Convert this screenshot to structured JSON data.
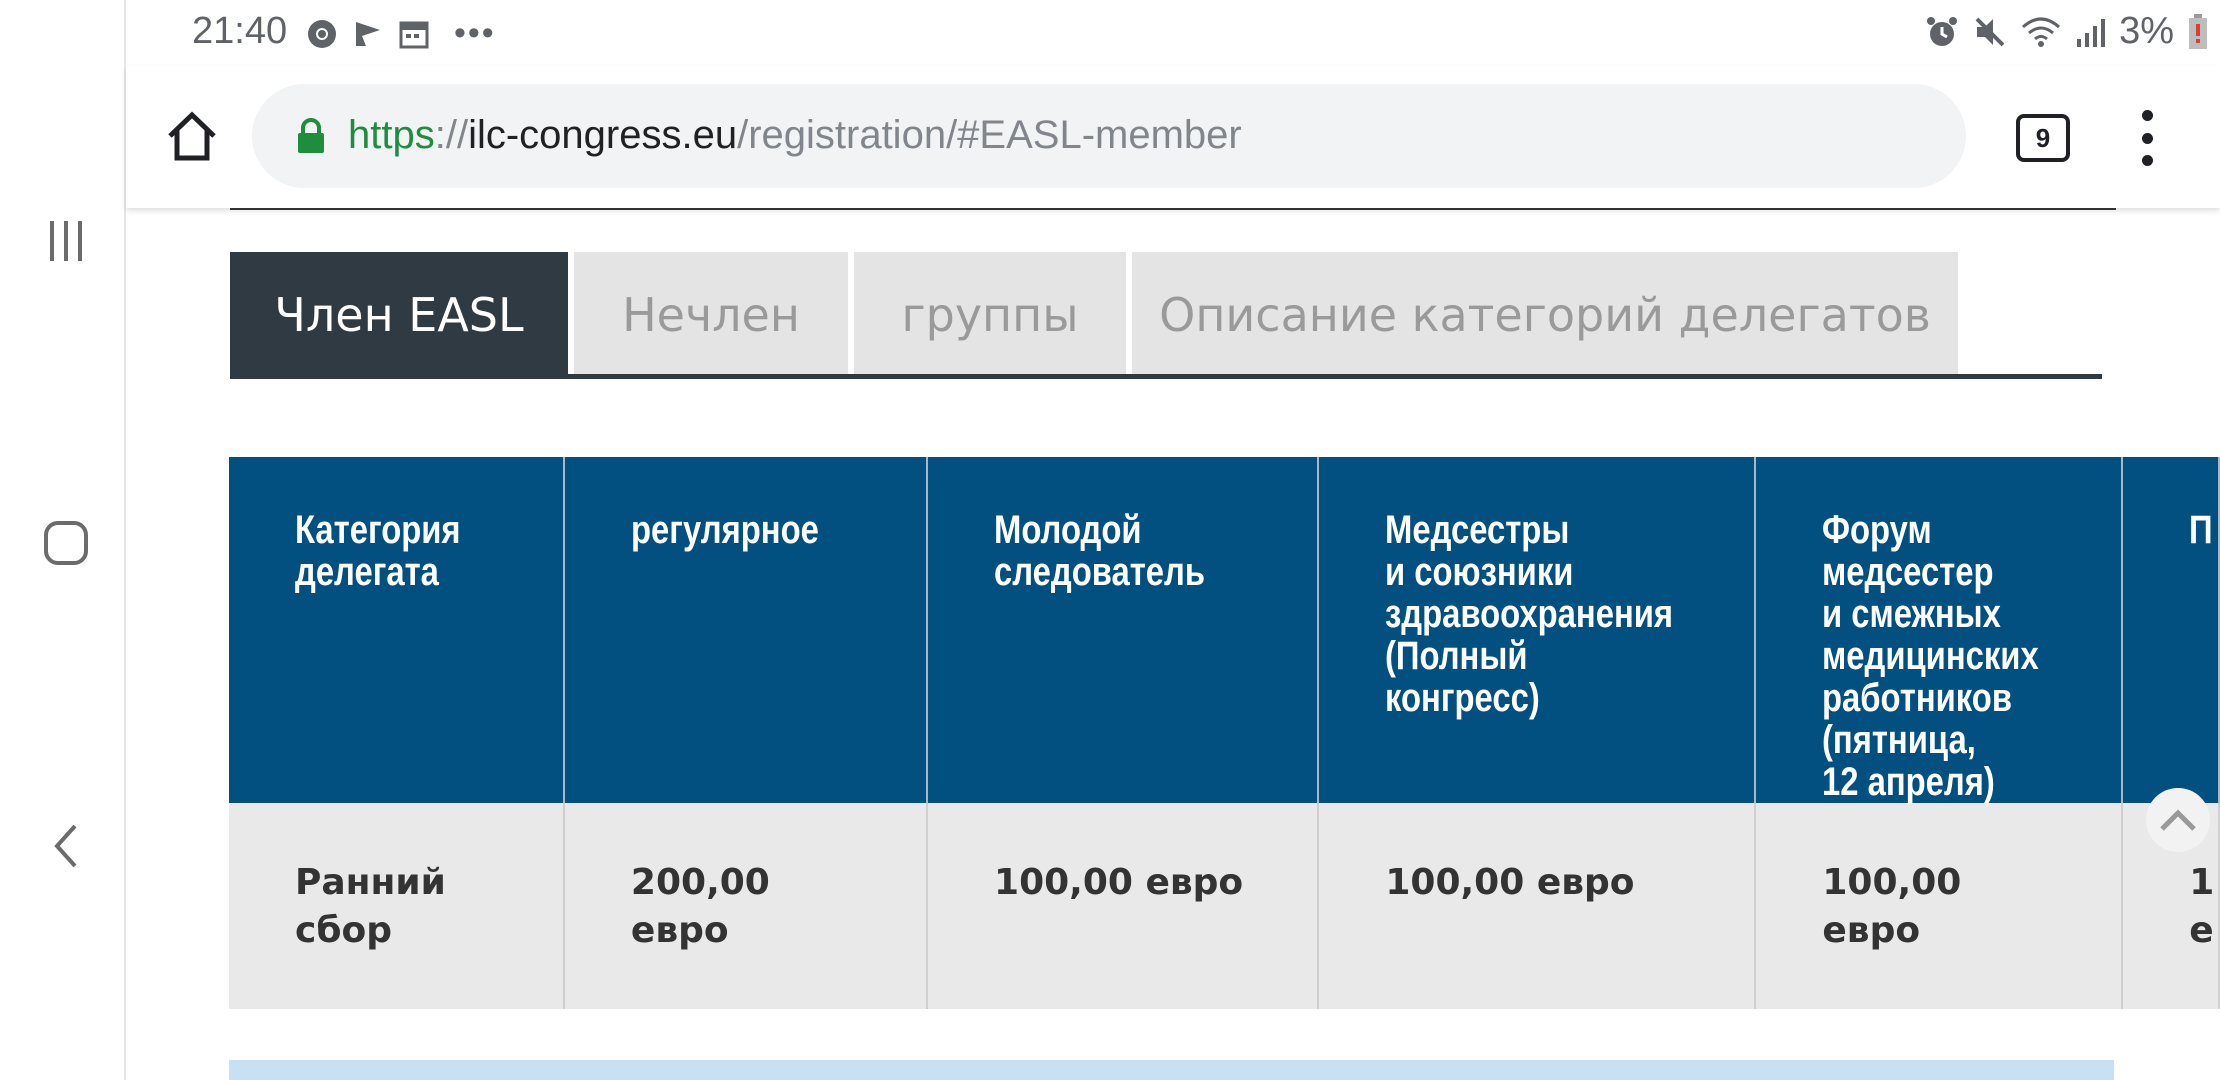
{
  "status_bar": {
    "time": "21:40",
    "battery": "3%",
    "left_icons": [
      "chrome-icon",
      "flag-icon",
      "calendar-icon",
      "more-notifications-icon"
    ],
    "right_icons": [
      "alarm-icon",
      "mute-icon",
      "wifi-icon",
      "signal-icon",
      "battery-icon"
    ]
  },
  "browser": {
    "url_scheme": "https",
    "url_sep": "://",
    "url_host": "ilc-congress.eu",
    "url_path": "/registration/#EASL-member",
    "tab_count": "9"
  },
  "page": {
    "tabs": [
      {
        "label": "Член EASL",
        "active": true
      },
      {
        "label": "Нечлен",
        "active": false
      },
      {
        "label": "группы",
        "active": false
      },
      {
        "label": "Описание категорий делегатов",
        "active": false
      }
    ],
    "table": {
      "headers": [
        "Категория делегата",
        "регулярное",
        "Молодой следователь",
        "Медсестры и союзники здравоохранения (Полный конгресс)",
        "Форум медсестер и смежных медицинских работников (пятница, 12 апреля)",
        "П"
      ],
      "rows": [
        [
          "Ранний сбор",
          "200,00 евро",
          "100,00 евро",
          "100,00 евро",
          "100,00 евро",
          "1 е"
        ]
      ]
    }
  },
  "colors": {
    "header_bg": "#02507f",
    "active_tab_bg": "#2f3a42",
    "url_green": "#1e8e3e"
  }
}
